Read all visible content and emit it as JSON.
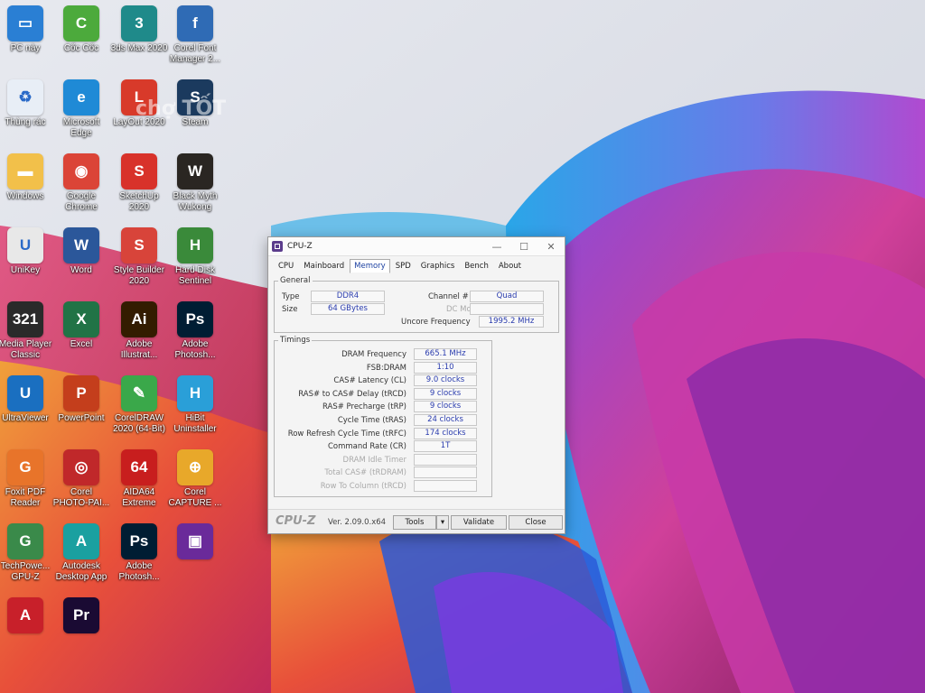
{
  "desktop_icons": [
    {
      "label": "PC này",
      "icon": "monitor-icon",
      "color": "#2a7fd4",
      "glyph": "▭"
    },
    {
      "label": "Cốc Cốc",
      "icon": "coccoc-icon",
      "color": "#4caa3c",
      "glyph": "C"
    },
    {
      "label": "3ds Max 2020",
      "icon": "3dsmax-icon",
      "color": "#1f8a8a",
      "glyph": "3"
    },
    {
      "label": "Corel Font\nManager 2...",
      "icon": "corel-font-icon",
      "color": "#2f6bb5",
      "glyph": "f"
    },
    {
      "label": "Thùng rác",
      "icon": "recycle-bin-icon",
      "color": "#e8eef6",
      "glyph": "♻"
    },
    {
      "label": "Microsoft\nEdge",
      "icon": "edge-icon",
      "color": "#1f8ad6",
      "glyph": "e"
    },
    {
      "label": "LayOut 2020",
      "icon": "layout-icon",
      "color": "#d83a2a",
      "glyph": "L"
    },
    {
      "label": "Steam",
      "icon": "steam-icon",
      "color": "#1b3a5e",
      "glyph": "S"
    },
    {
      "label": "Windows",
      "icon": "folder-icon",
      "color": "#f2c04a",
      "glyph": "▬"
    },
    {
      "label": "Google\nChrome",
      "icon": "chrome-icon",
      "color": "#db4437",
      "glyph": "◉"
    },
    {
      "label": "SketchUp\n2020",
      "icon": "sketchup-icon",
      "color": "#d8322a",
      "glyph": "S"
    },
    {
      "label": "Black Myth\nWukong",
      "icon": "wukong-icon",
      "color": "#2a2622",
      "glyph": "W"
    },
    {
      "label": "UniKey",
      "icon": "unikey-icon",
      "color": "#e8e8e8",
      "glyph": "U"
    },
    {
      "label": "Word",
      "icon": "word-icon",
      "color": "#2b579a",
      "glyph": "W"
    },
    {
      "label": "Style Builder\n2020",
      "icon": "style-builder-icon",
      "color": "#d8443a",
      "glyph": "S"
    },
    {
      "label": "Hard Disk\nSentinel",
      "icon": "hdsentinel-icon",
      "color": "#3a8a3a",
      "glyph": "H"
    },
    {
      "label": "Media Player\nClassic",
      "icon": "mpc-icon",
      "color": "#2a2a2a",
      "glyph": "321"
    },
    {
      "label": "Excel",
      "icon": "excel-icon",
      "color": "#217346",
      "glyph": "X"
    },
    {
      "label": "Adobe\nIllustrat...",
      "icon": "illustrator-icon",
      "color": "#331c00",
      "glyph": "Ai"
    },
    {
      "label": "Adobe\nPhotosh...",
      "icon": "photoshop-icon",
      "color": "#001d33",
      "glyph": "Ps"
    },
    {
      "label": "UltraViewer",
      "icon": "ultraviewer-icon",
      "color": "#1a6fc0",
      "glyph": "U"
    },
    {
      "label": "PowerPoint",
      "icon": "powerpoint-icon",
      "color": "#c43e1c",
      "glyph": "P"
    },
    {
      "label": "CorelDRAW\n2020 (64-Bit)",
      "icon": "coreldraw-icon",
      "color": "#3aa84a",
      "glyph": "✎"
    },
    {
      "label": "HiBit\nUninstaller",
      "icon": "hibit-icon",
      "color": "#2a9fd8",
      "glyph": "H"
    },
    {
      "label": "Foxit PDF\nReader",
      "icon": "foxit-icon",
      "color": "#e8742a",
      "glyph": "G"
    },
    {
      "label": "Corel\nPHOTO-PAI...",
      "icon": "photopaint-icon",
      "color": "#c0282a",
      "glyph": "◎"
    },
    {
      "label": "AIDA64\nExtreme",
      "icon": "aida64-icon",
      "color": "#c81e1e",
      "glyph": "64"
    },
    {
      "label": "Corel\nCAPTURE ...",
      "icon": "corel-capture-icon",
      "color": "#e8a82a",
      "glyph": "⊕"
    },
    {
      "label": "TechPowe...\nGPU-Z",
      "icon": "gpuz-icon",
      "color": "#3a8a4a",
      "glyph": "G"
    },
    {
      "label": "Autodesk\nDesktop App",
      "icon": "autodesk-icon",
      "color": "#1aa0a0",
      "glyph": "A"
    },
    {
      "label": "Adobe\nPhotosh...",
      "icon": "photoshop-icon-2",
      "color": "#001d33",
      "glyph": "Ps"
    },
    {
      "label": "",
      "icon": "cpu-chip-icon",
      "color": "#6a2a9a",
      "glyph": "▣"
    },
    {
      "label": "",
      "icon": "autocad-icon",
      "color": "#c8202a",
      "glyph": "A"
    },
    {
      "label": "",
      "icon": "premiere-icon",
      "color": "#1a0a33",
      "glyph": "Pr"
    }
  ],
  "watermark": "chợ TỐT",
  "cpuz": {
    "title": "CPU-Z",
    "tabs": [
      "CPU",
      "Mainboard",
      "Memory",
      "SPD",
      "Graphics",
      "Bench",
      "About"
    ],
    "active_tab": "Memory",
    "general": {
      "label": "General",
      "type_label": "Type",
      "type_value": "DDR4",
      "size_label": "Size",
      "size_value": "64 GBytes",
      "channel_label": "Channel #",
      "channel_value": "Quad",
      "dc_mode_label": "DC Mode",
      "dc_mode_value": "",
      "uncore_label": "Uncore Frequency",
      "uncore_value": "1995.2 MHz"
    },
    "timings": {
      "label": "Timings",
      "rows": [
        {
          "label": "DRAM Frequency",
          "value": "665.1 MHz",
          "enabled": true
        },
        {
          "label": "FSB:DRAM",
          "value": "1:10",
          "enabled": true
        },
        {
          "label": "CAS# Latency (CL)",
          "value": "9.0 clocks",
          "enabled": true
        },
        {
          "label": "RAS# to CAS# Delay (tRCD)",
          "value": "9 clocks",
          "enabled": true
        },
        {
          "label": "RAS# Precharge (tRP)",
          "value": "9 clocks",
          "enabled": true
        },
        {
          "label": "Cycle Time (tRAS)",
          "value": "24 clocks",
          "enabled": true
        },
        {
          "label": "Row Refresh Cycle Time (tRFC)",
          "value": "174 clocks",
          "enabled": true
        },
        {
          "label": "Command Rate (CR)",
          "value": "1T",
          "enabled": true
        },
        {
          "label": "DRAM Idle Timer",
          "value": "",
          "enabled": false
        },
        {
          "label": "Total CAS# (tRDRAM)",
          "value": "",
          "enabled": false
        },
        {
          "label": "Row To Column (tRCD)",
          "value": "",
          "enabled": false
        }
      ]
    },
    "footer": {
      "logo": "CPU-Z",
      "version": "Ver. 2.09.0.x64",
      "tools_label": "Tools",
      "validate_label": "Validate",
      "close_label": "Close"
    }
  }
}
